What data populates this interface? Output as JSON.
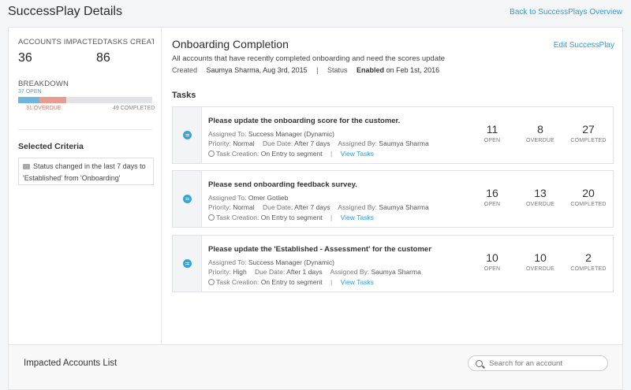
{
  "header": {
    "title": "SuccessPlay Details",
    "back_link": "Back to SuccessPlays Overview"
  },
  "summary": {
    "labels": "ACCOUNTS IMPACTEDTASKS CREAT...",
    "accounts_impacted": "36",
    "tasks_created": "86",
    "breakdown_label": "BREAKDOWN",
    "open_label": "37 OPEN",
    "overdue_label": "31 OVERDUE",
    "completed_label": "49 COMPLETED",
    "colors": {
      "open": "#6eb6df",
      "overdue": "#e89b91",
      "completed": "#e2e3e5"
    }
  },
  "criteria": {
    "title": "Selected Criteria",
    "text": "Status changed in the last 7 days to 'Established' from 'Onboarding'"
  },
  "successplay": {
    "title": "Onboarding Completion",
    "edit_link": "Edit SuccessPlay",
    "description": "All accounts that have recently completed onboarding and need the scores update",
    "created_label": "Created",
    "created_value": "Saumya Sharma, Aug 3rd, 2015",
    "divider": "|",
    "status_label": "Status",
    "status_value_bold": "Enabled",
    "status_value_rest": " on Feb 1st, 2016"
  },
  "tasks": {
    "title": "Tasks",
    "items": [
      {
        "title": "Please update the onboarding score for the customer.",
        "assigned_to_label": "Assigned To:",
        "assigned_to": "Success Manager (Dynamic)",
        "priority_label": "Priority:",
        "priority": "Normal",
        "due_label": "Due Date:",
        "due": "After 7 days",
        "assigned_by_label": "Assigned By:",
        "assigned_by": "Saumya Sharma",
        "creation_label": "Task Creation:",
        "creation": "On Entry to segment",
        "view_link": "View Tasks",
        "open": "11",
        "overdue": "8",
        "completed": "27"
      },
      {
        "title": "Please send onboarding feedback survey.",
        "assigned_to_label": "Assigned To:",
        "assigned_to": "Omer Gotlieb",
        "priority_label": "Priority:",
        "priority": "Normal",
        "due_label": "Due Date:",
        "due": "After 7 days",
        "assigned_by_label": "Assigned By:",
        "assigned_by": "Saumya Sharma",
        "creation_label": "Task Creation:",
        "creation": "On Entry to segment",
        "view_link": "View Tasks",
        "open": "16",
        "overdue": "13",
        "completed": "20"
      },
      {
        "title": "Please update the 'Established - Assessment' for the customer",
        "assigned_to_label": "Assigned To:",
        "assigned_to": "Success Manager (Dynamic)",
        "priority_label": "Priority:",
        "priority": "High",
        "due_label": "Due Date:",
        "due": "After 1 days",
        "assigned_by_label": "Assigned By:",
        "assigned_by": "Saumya Sharma",
        "creation_label": "Task Creation:",
        "creation": "On Entry to segment",
        "view_link": "View Tasks",
        "open": "10",
        "overdue": "10",
        "completed": "2"
      }
    ],
    "stat_labels": {
      "open": "OPEN",
      "overdue": "OVERDUE",
      "completed": "COMPLETED"
    },
    "separator": "|"
  },
  "footer": {
    "title": "Impacted Accounts List",
    "search_placeholder": "Search for an account"
  },
  "accent_color": "#2d9bd6"
}
